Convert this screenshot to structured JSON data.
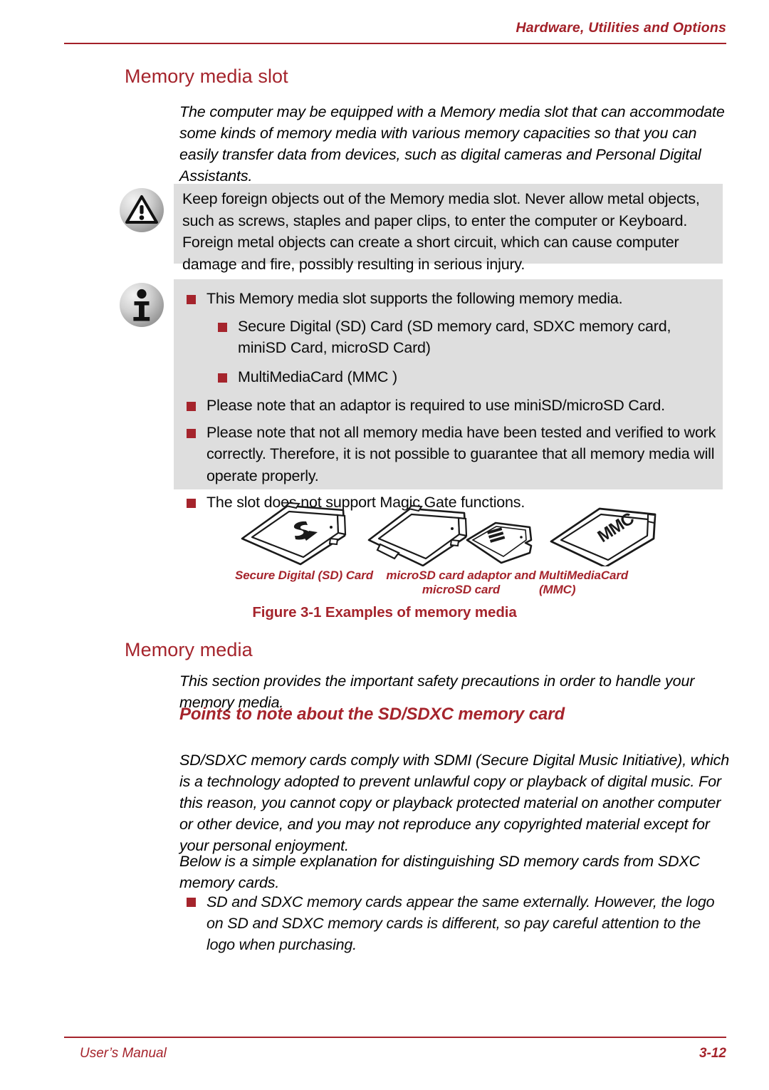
{
  "header": {
    "running_head": "Hardware, Utilities and Options"
  },
  "colors": {
    "accent_red": "#a5242c",
    "note_box_grey": "#dedede",
    "body_text": "#0a0a0a"
  },
  "sections": [
    {
      "heading": "Memory media slot",
      "intro": "The computer may be equipped with a Memory media slot that can accommodate some kinds of memory media with various memory capacities so that you can easily transfer data from devices, such as digital cameras and Personal Digital Assistants."
    },
    {
      "heading": "Memory media",
      "intro": "This section provides the important safety precautions in order to handle your memory media."
    }
  ],
  "warning_box": {
    "icon": "warning-triangle-icon",
    "text": "Keep foreign objects out of the Memory media slot. Never allow metal objects, such as screws, staples and paper clips, to enter the computer or Keyboard. Foreign metal objects can create a short circuit, which can cause computer damage and fire, possibly resulting in serious injury."
  },
  "info_box": {
    "icon": "information-icon",
    "items": [
      {
        "text": "This Memory media slot supports the following memory media.",
        "subitems": [
          "Secure Digital (SD) Card (SD memory card, SDXC memory card, miniSD Card, microSD Card)",
          "MultiMediaCard (MMC )"
        ]
      },
      {
        "text": "Please note that an adaptor is required to use miniSD/microSD Card.",
        "subitems": []
      },
      {
        "text": "Please note that not all memory media have been tested and verified to work correctly. Therefore, it is not possible to guarantee that all memory media will operate properly.",
        "subitems": []
      },
      {
        "text": "The slot does not support Magic Gate functions.",
        "subitems": []
      }
    ]
  },
  "figure": {
    "caption": "Figure 3-1 Examples of memory media",
    "cards": [
      {
        "label": "Secure Digital (SD) Card",
        "logo": "sd-logo",
        "icon": "sd-card-icon"
      },
      {
        "label": "microSD card adaptor and microSD card",
        "logo": "microsd-logo",
        "icon": "microsd-adaptor-icon"
      },
      {
        "label": "MultiMediaCard (MMC)",
        "logo": "MMC",
        "icon": "mmc-card-icon"
      }
    ]
  },
  "subsection": {
    "heading": "Points to note about the SD/SDXC memory card",
    "paragraph_1": "SD/SDXC memory cards comply with SDMI (Secure Digital Music Initiative), which is a technology adopted to prevent unlawful copy or playback of digital music. For this reason, you cannot copy or playback protected material on another computer or other device, and you may not reproduce any copyrighted material except for your personal enjoyment.",
    "paragraph_2": "Below is a simple explanation for distinguishing SD memory cards from SDXC memory cards.",
    "bullets": [
      "SD and SDXC memory cards appear the same externally. However, the logo on SD and SDXC memory cards is different, so pay careful attention to the logo when purchasing."
    ]
  },
  "footer": {
    "left": "User’s Manual",
    "page_number": "3-12"
  }
}
